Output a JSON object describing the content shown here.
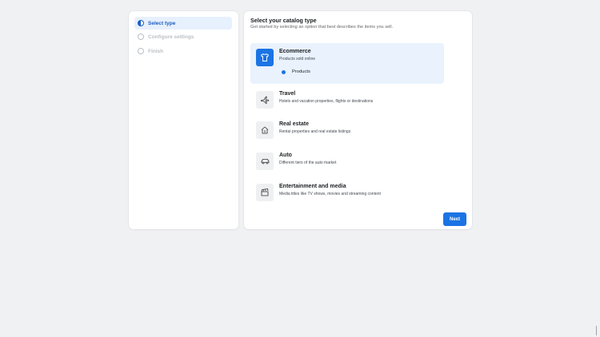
{
  "steps": [
    {
      "label": "Select type",
      "state": "active"
    },
    {
      "label": "Configure settings",
      "state": "inactive"
    },
    {
      "label": "Finish",
      "state": "inactive"
    }
  ],
  "main": {
    "title": "Select your catalog type",
    "subtitle": "Get started by selecting an option that best describes the items you sell."
  },
  "options": [
    {
      "title": "Ecommerce",
      "description": "Products sold online",
      "icon": "tshirt-icon",
      "selected": true,
      "sub_option": {
        "label": "Products",
        "selected": true
      }
    },
    {
      "title": "Travel",
      "description": "Hotels and vacation properties, flights or destinations",
      "icon": "airplane-icon",
      "selected": false
    },
    {
      "title": "Real estate",
      "description": "Rental properties and real estate listings",
      "icon": "house-icon",
      "selected": false
    },
    {
      "title": "Auto",
      "description": "Different tiers of the auto market",
      "icon": "car-icon",
      "selected": false
    },
    {
      "title": "Entertainment and media",
      "description": "Media titles like TV shows, movies and streaming content",
      "icon": "clapperboard-icon",
      "selected": false
    }
  ],
  "actions": {
    "next_label": "Next"
  },
  "colors": {
    "accent": "#1b74e4",
    "selected_bg": "#e9f2fd",
    "page_bg": "#f0f1f3"
  }
}
